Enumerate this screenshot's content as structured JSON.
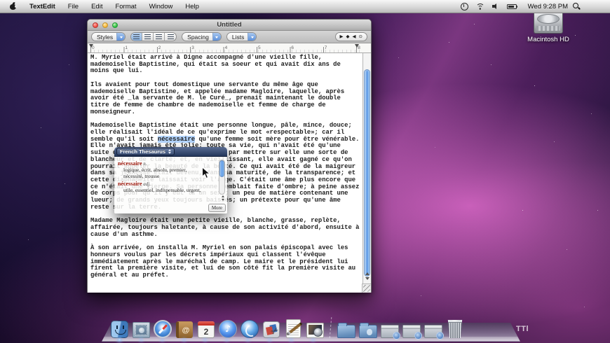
{
  "menu_bar": {
    "apple_icon": "apple-logo",
    "items": [
      "TextEdit",
      "File",
      "Edit",
      "Format",
      "Window",
      "Help"
    ],
    "status_icons": [
      "time-machine",
      "wifi",
      "volume",
      "battery"
    ],
    "clock": "Wed 9:28 PM",
    "spotlight_icon": "magnifier"
  },
  "desktop": {
    "hd_label": "Macintosh HD",
    "watermark": "TTl"
  },
  "window": {
    "title": "Untitled",
    "toolbar": {
      "styles_label": "Styles",
      "spacing_label": "Spacing",
      "lists_label": "Lists",
      "align_segments": [
        "align-left",
        "align-center",
        "align-justify",
        "align-right"
      ],
      "tab_icons": [
        {
          "name": "tab-left",
          "glyph": "▶"
        },
        {
          "name": "tab-center",
          "glyph": "◆"
        },
        {
          "name": "tab-right",
          "glyph": "◀"
        },
        {
          "name": "tab-decimal",
          "glyph": "⊙"
        }
      ]
    },
    "ruler_numbers": [
      "0",
      "1",
      "2",
      "3",
      "4",
      "5",
      "6",
      "7",
      "8"
    ],
    "document": {
      "lines": [
        "M. Myriel était arrivé à Digne accompagné d'une vieille fille,",
        "mademoiselle Baptistine, qui était sa soeur et qui avait dix ans de",
        "moins que lui.",
        "",
        "Ils avaient pour tout domestique une servante du même âge que",
        "mademoiselle Baptistine, et appelée madame Magloire, laquelle, après",
        "avoir été _la servante de M. le Curé_, prenait maintenant le double",
        "titre de femme de chambre de mademoiselle et femme de charge de",
        "monseigneur.",
        "",
        "Mademoiselle Baptistine était une personne longue, pâle, mince, douce;",
        "elle réalisait l'idéal de ce qu'exprime le mot «respectable»; car il",
        "semble qu'il soit nécessaire qu'une femme soit mère pour être vénérable.",
        "Elle n'avait jamais été jolie; toute sa vie, qui n'avait été qu'une",
        "suite de saintes oeuvres, avait fini par mettre sur elle une sorte de",
        "blancheur et de clarté; et, en vieillissant, elle avait gagné ce qu'on",
        "pourrait appeler la beauté de la bonté. Ce qui avait été de la maigreur",
        "dans sa jeunesse était devenu, dans sa maturité, de la transparence; et",
        "cette diaphanéité laissait voir l'ange. C'était une âme plus encore que",
        "ce n'était une vierge. Sa personne semblait faite d'ombre; à peine assez",
        "de corps pour qu'il y eût là un sexe; un peu de matière contenant une",
        "lueur; de grands yeux toujours baissés; un prétexte pour qu'une âme",
        "reste sur la terre.",
        "",
        "Madame Magloire était une petite vieille, blanche, grasse, replète,",
        "affairée, toujours haletante, à cause de son activité d'abord, ensuite à",
        "cause d'un asthme.",
        "",
        "À son arrivée, on installa M. Myriel en son palais épiscopal avec les",
        "honneurs voulus par les décrets impériaux qui classent l'évêque",
        "immédiatement après le maréchal de camp. Le maire et le président lui",
        "firent la première visite, et lui de son côté fit la première visite au",
        "général et au préfet."
      ],
      "selection": {
        "line": 12,
        "pre": "semble qu'il soit ",
        "text": "nécessaire",
        "post": " qu'une femme soit mère pour être vénérable."
      }
    }
  },
  "thesaurus": {
    "title": "French Thesaurus",
    "entries": [
      {
        "word": "nécessaire",
        "pos": "n.",
        "lines": [
          "logique, écrit, absolu, premier,",
          "nécessité, trousse"
        ]
      },
      {
        "word": "nécessaire",
        "pos": "adj.",
        "lines": [
          "utile, essentiel, indispensable, urgent,"
        ]
      }
    ],
    "more_label": "More"
  },
  "dock": {
    "ical_day": "2",
    "items": [
      {
        "name": "finder"
      },
      {
        "name": "mail"
      },
      {
        "name": "safari"
      },
      {
        "name": "address-book"
      },
      {
        "name": "ical"
      },
      {
        "name": "itunes"
      },
      {
        "name": "camino"
      },
      {
        "name": "preview"
      },
      {
        "name": "textedit"
      },
      {
        "name": "iphoto"
      },
      {
        "name": "separator"
      },
      {
        "name": "documents-folder"
      },
      {
        "name": "applications-folder"
      },
      {
        "name": "minimized-window"
      },
      {
        "name": "minimized-window"
      },
      {
        "name": "minimized-window"
      },
      {
        "name": "trash"
      }
    ]
  },
  "colors": {
    "selection_highlight": "#b4d5fd",
    "thesaurus_headword": "#9b1408",
    "thesaurus_header": "#24375c",
    "aqua_scrollbar": "#5f9ae6"
  }
}
